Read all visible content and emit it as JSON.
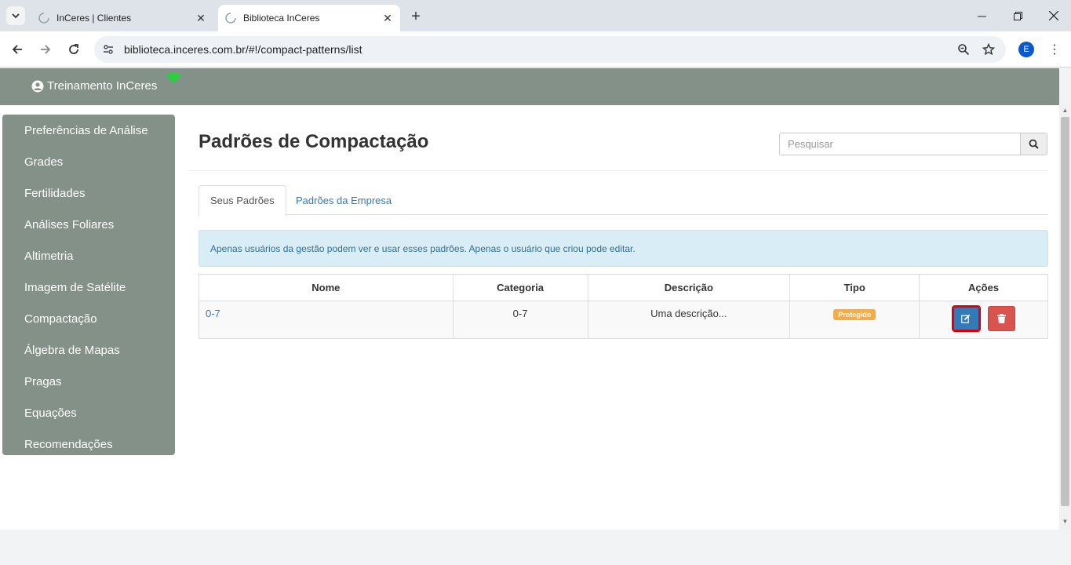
{
  "browser": {
    "tabs": [
      {
        "title": "InCeres | Clientes",
        "active": false
      },
      {
        "title": "Biblioteca InCeres",
        "active": true
      }
    ],
    "url": "biblioteca.inceres.com.br/#!/compact-patterns/list",
    "profile_initial": "E"
  },
  "app": {
    "user_name": "Treinamento InCeres",
    "status_color": "#2ecc40"
  },
  "sidebar": {
    "items": [
      {
        "label": "Preferências de Análise"
      },
      {
        "label": "Grades"
      },
      {
        "label": "Fertilidades"
      },
      {
        "label": "Análises Foliares"
      },
      {
        "label": "Altimetria"
      },
      {
        "label": "Imagem de Satélite"
      },
      {
        "label": "Compactação"
      },
      {
        "label": "Álgebra de Mapas"
      },
      {
        "label": "Pragas"
      },
      {
        "label": "Equações"
      },
      {
        "label": "Recomendações"
      }
    ]
  },
  "main": {
    "title": "Padrões de Compactação",
    "search_placeholder": "Pesquisar",
    "tabs": [
      {
        "label": "Seus Padrões",
        "active": true
      },
      {
        "label": "Padrões da Empresa",
        "active": false
      }
    ],
    "alert": "Apenas usuários da gestão podem ver e usar esses padrões. Apenas o usuário que criou pode editar.",
    "table": {
      "headers": [
        "Nome",
        "Categoria",
        "Descrição",
        "Tipo",
        "Ações"
      ],
      "rows": [
        {
          "nome": "0-7",
          "categoria": "0-7",
          "descricao": "Uma descrição...",
          "tipo": "Protegido"
        }
      ]
    }
  },
  "colors": {
    "sidebar_bg": "#849189",
    "primary": "#337ab7",
    "danger": "#d9534f",
    "warning": "#f0ad4e"
  }
}
